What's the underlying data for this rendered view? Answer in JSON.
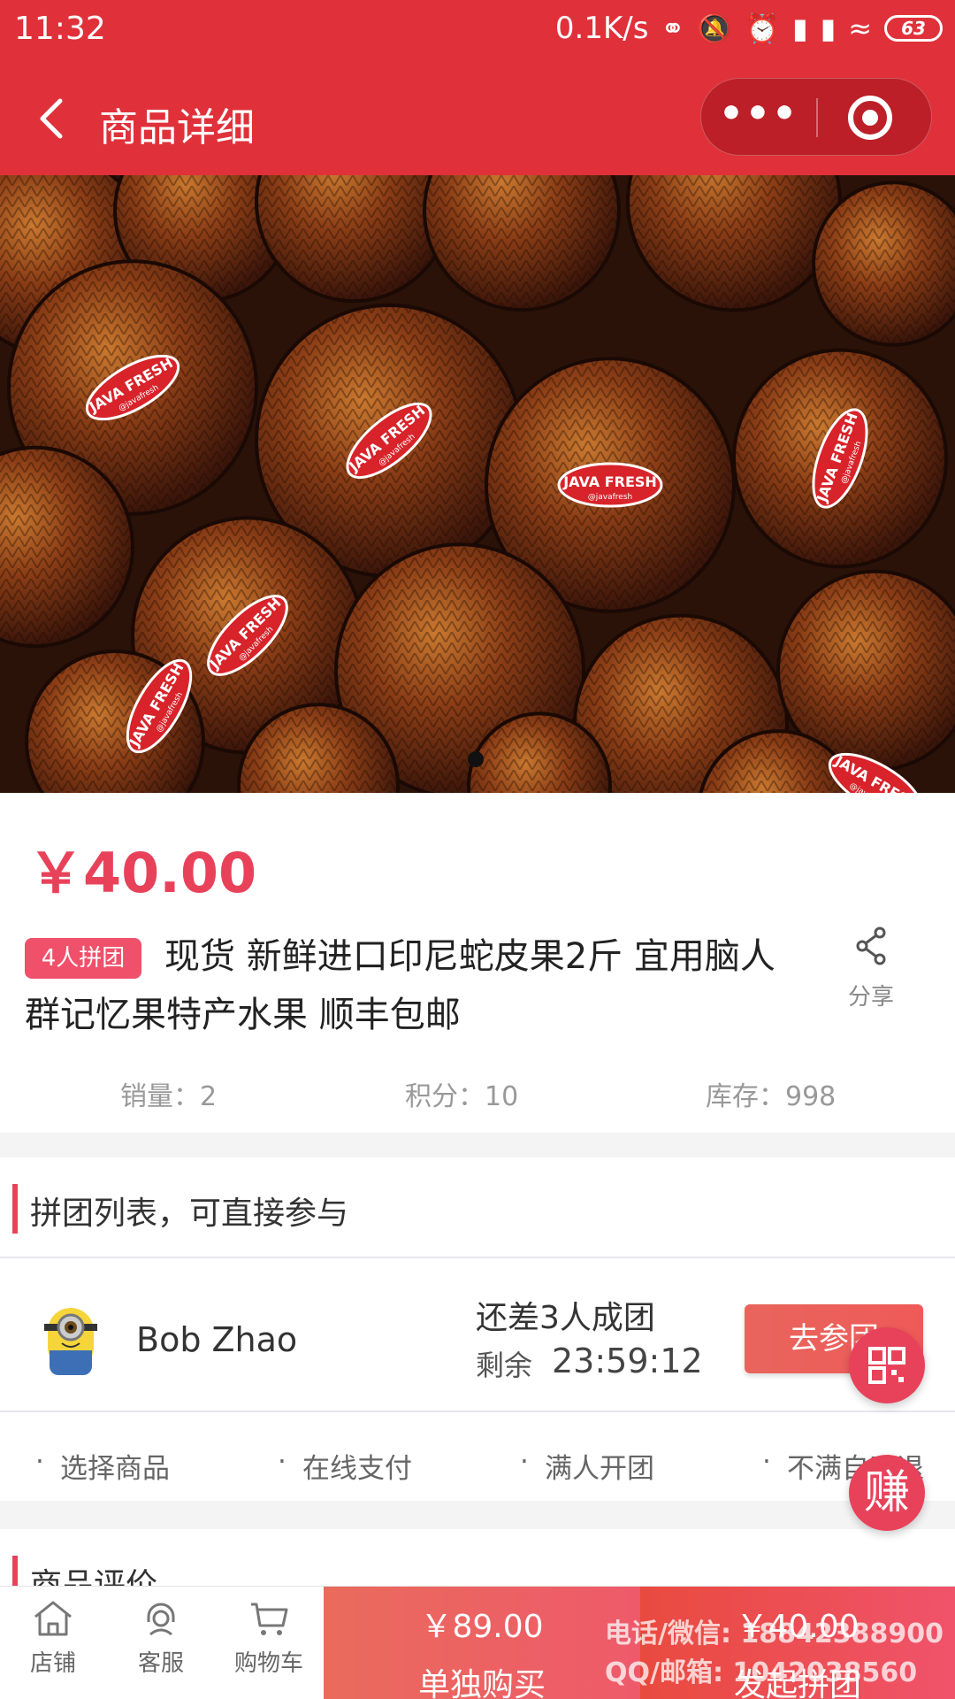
{
  "status_bar": {
    "time": "11:32",
    "network_speed": "0.1K/s",
    "battery": "63"
  },
  "nav": {
    "title": "商品详细"
  },
  "product": {
    "price": "￥40.00",
    "group_tag": "4人拼团",
    "title": "现货 新鲜进口印尼蛇皮果2斤 宜用脑人群记忆果特产水果 顺丰包邮",
    "share_label": "分享",
    "stats": {
      "sales": "销量：2",
      "points": "积分：10",
      "stock": "库存：998"
    },
    "image_label": "JAVA FRESH",
    "image_handle": "@javafresh"
  },
  "group_list": {
    "heading": "拼团列表，可直接参与",
    "entries": [
      {
        "name": "Bob Zhao",
        "need": "还差3人成团",
        "remain_label": "剩余",
        "remain_time": "23:59:12",
        "join_label": "去参团"
      }
    ],
    "steps": [
      "选择商品",
      "在线支付",
      "满人开团",
      "不满自动退"
    ]
  },
  "reviews": {
    "heading": "商品评价"
  },
  "floating": {
    "earn_label": "赚"
  },
  "bottom_bar": {
    "tabs": [
      {
        "label": "店铺",
        "icon": "home-icon"
      },
      {
        "label": "客服",
        "icon": "headset-icon"
      },
      {
        "label": "购物车",
        "icon": "cart-icon"
      }
    ],
    "single": {
      "price": "￥89.00",
      "label": "单独购买"
    },
    "group": {
      "price": "￥40.00",
      "label": "发起拼团"
    },
    "watermark": {
      "line1": "电话/微信: 18842388900",
      "line2": "QQ/邮箱: 1042038560"
    }
  },
  "colors": {
    "brand_red": "#e0313a",
    "accent_pink": "#e8425a"
  }
}
